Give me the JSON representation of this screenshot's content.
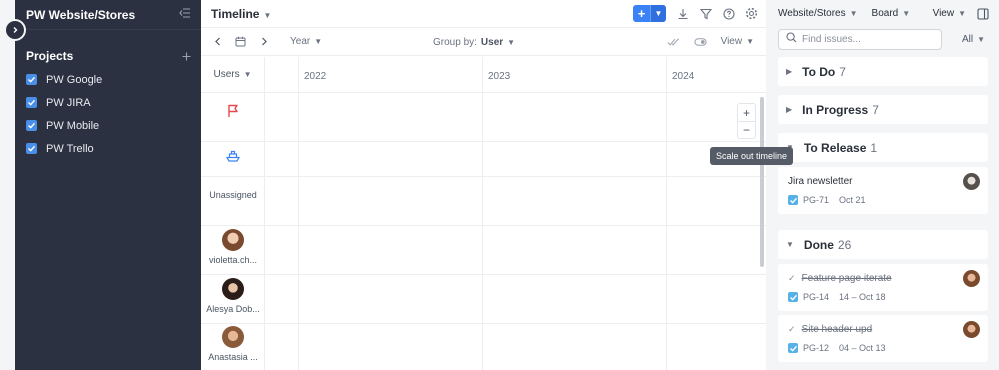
{
  "sidebar": {
    "title": "PW Website/Stores",
    "section_title": "Projects",
    "projects": [
      {
        "label": "PW Google",
        "checked": true
      },
      {
        "label": "PW JIRA",
        "checked": true
      },
      {
        "label": "PW Mobile",
        "checked": true
      },
      {
        "label": "PW Trello",
        "checked": true
      }
    ]
  },
  "timeline": {
    "title": "Timeline",
    "toolbar": {
      "period": "Year",
      "group_by_label": "Group by:",
      "group_by_value": "User",
      "view_label": "View"
    },
    "users_header": "Users",
    "years": [
      "2022",
      "2023",
      "2024"
    ],
    "lanes": {
      "unassigned": "Unassigned",
      "users": [
        "violetta.ch...",
        "Alesya Dob...",
        "Anastasia ..."
      ]
    },
    "zoom_in": "+",
    "zoom_out": "−",
    "tooltip": "Scale out timeline"
  },
  "board": {
    "breadcrumb": "Website/Stores",
    "board_label": "Board",
    "view_label": "View",
    "search_placeholder": "Find issues...",
    "filter": "All",
    "groups": [
      {
        "title": "To Do",
        "count": "7"
      },
      {
        "title": "In Progress",
        "count": "7"
      },
      {
        "title": "To Release",
        "count": "1"
      },
      {
        "title": "Done",
        "count": "26"
      }
    ],
    "cards": [
      {
        "title": "Jira newsletter",
        "key": "PG-71",
        "date": "Oct 21",
        "done": false
      },
      {
        "title": "Feature page iterate",
        "key": "PG-14",
        "date": "14 – Oct 18",
        "done": true
      },
      {
        "title": "Site header upd",
        "key": "PG-12",
        "date": "04 – Oct 13",
        "done": true
      }
    ]
  },
  "colors": {
    "sidebar_bg": "#2b3140",
    "accent": "#3b82f6",
    "flag": "#e5484d",
    "ship": "#3b82f6",
    "checkbox": "#4a8fe7"
  }
}
